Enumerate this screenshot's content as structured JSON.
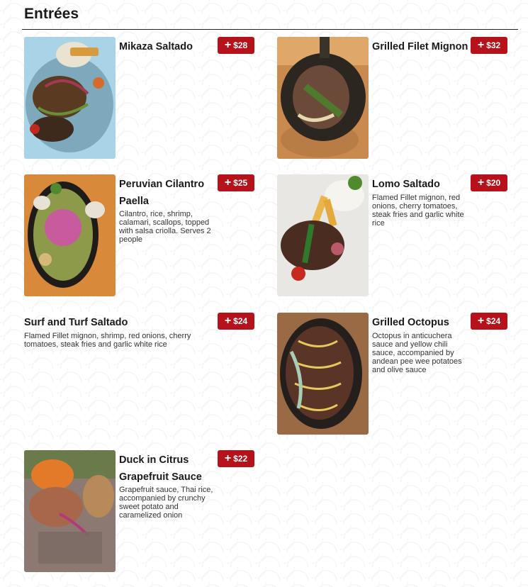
{
  "section": {
    "title": "Entrées"
  },
  "items": [
    {
      "name": "Mikaza Saltado",
      "price": "$28",
      "description": ""
    },
    {
      "name": "Grilled Filet Mignon",
      "price": "$32",
      "description": ""
    },
    {
      "name": "Peruvian Cilantro Paella",
      "price": "$25",
      "description": "Cilantro, rice, shrimp, calamari, scallops, topped with salsa criolla. Serves 2 people"
    },
    {
      "name": "Lomo Saltado",
      "price": "$20",
      "description": "Flamed Fillet mignon, red onions, cherry tomatoes, steak fries and garlic white rice"
    },
    {
      "name": "Surf and Turf Saltado",
      "price": "$24",
      "description": "Flamed Fillet mignon, shrimp, red onions, cherry tomatoes, steak fries and garlic white rice"
    },
    {
      "name": "Grilled Octopus",
      "price": "$24",
      "description": "Octopus in anticuchera sauce and yellow chili sauce, accompanied by andean pee wee potatoes and olive sauce"
    },
    {
      "name": "Duck in Citrus Grapefruit Sauce",
      "price": "$22",
      "description": "Grapefruit sauce, Thai rice, accompanied by crunchy sweet potato and caramelized onion"
    }
  ],
  "icons": {
    "add": "plus-icon"
  },
  "colors": {
    "price_button": "#b5121b",
    "text": "#1a1a1a"
  }
}
